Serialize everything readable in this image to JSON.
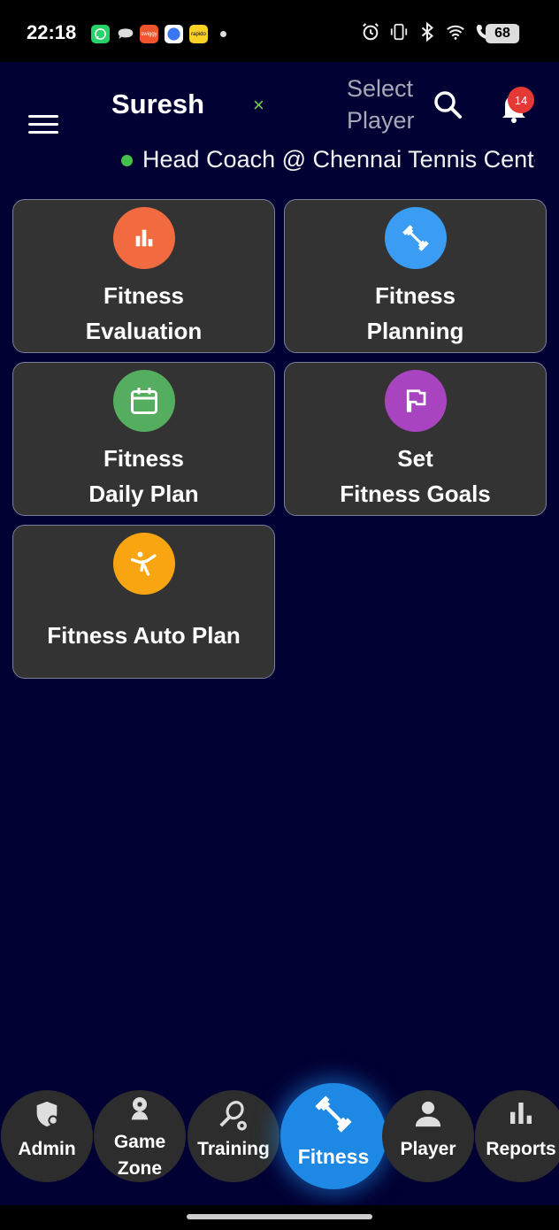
{
  "status_bar": {
    "time": "22:18",
    "apps": [
      "whatsapp",
      "chat",
      "swiggy",
      "signal",
      "rapido"
    ],
    "app_labels": {
      "swiggy": "swiggy",
      "rapido": "rapido"
    },
    "battery": "68"
  },
  "header": {
    "coach_name": "Suresh",
    "clear_symbol": "×",
    "select_player_line1": "Select",
    "select_player_line2": "Player",
    "notification_count": "14",
    "status_text": "Head Coach @ Chennai Tennis Center"
  },
  "tiles": [
    {
      "line1": "Fitness",
      "line2": "Evaluation",
      "icon": "bar-chart-icon",
      "color": "#f26a3f"
    },
    {
      "line1": "Fitness",
      "line2": "Planning",
      "icon": "dumbbell-icon",
      "color": "#3a9cf2"
    },
    {
      "line1": "Fitness",
      "line2": "Daily Plan",
      "icon": "calendar-icon",
      "color": "#55ae5f"
    },
    {
      "line1": "Set",
      "line2": "Fitness Goals",
      "icon": "flag-icon",
      "color": "#a944c0"
    },
    {
      "line1": "Fitness Auto Plan",
      "icon": "yoga-pose-icon",
      "color": "#f8a511"
    }
  ],
  "bottom_nav": [
    {
      "label": "Admin",
      "icon": "admin-shield-icon"
    },
    {
      "label_line1": "Game",
      "label_line2": "Zone",
      "icon": "game-zone-gear-icon"
    },
    {
      "label": "Training",
      "icon": "racket-icon"
    },
    {
      "label": "Fitness",
      "icon": "dumbbell-icon",
      "active": true
    },
    {
      "label": "Player",
      "icon": "person-icon"
    },
    {
      "label": "Reports",
      "icon": "bar-chart-icon"
    }
  ],
  "colors": {
    "background": "#020133",
    "tile": "#333333",
    "active_nav": "#1e88e5",
    "badge": "#e53935",
    "online": "#45c04a"
  }
}
